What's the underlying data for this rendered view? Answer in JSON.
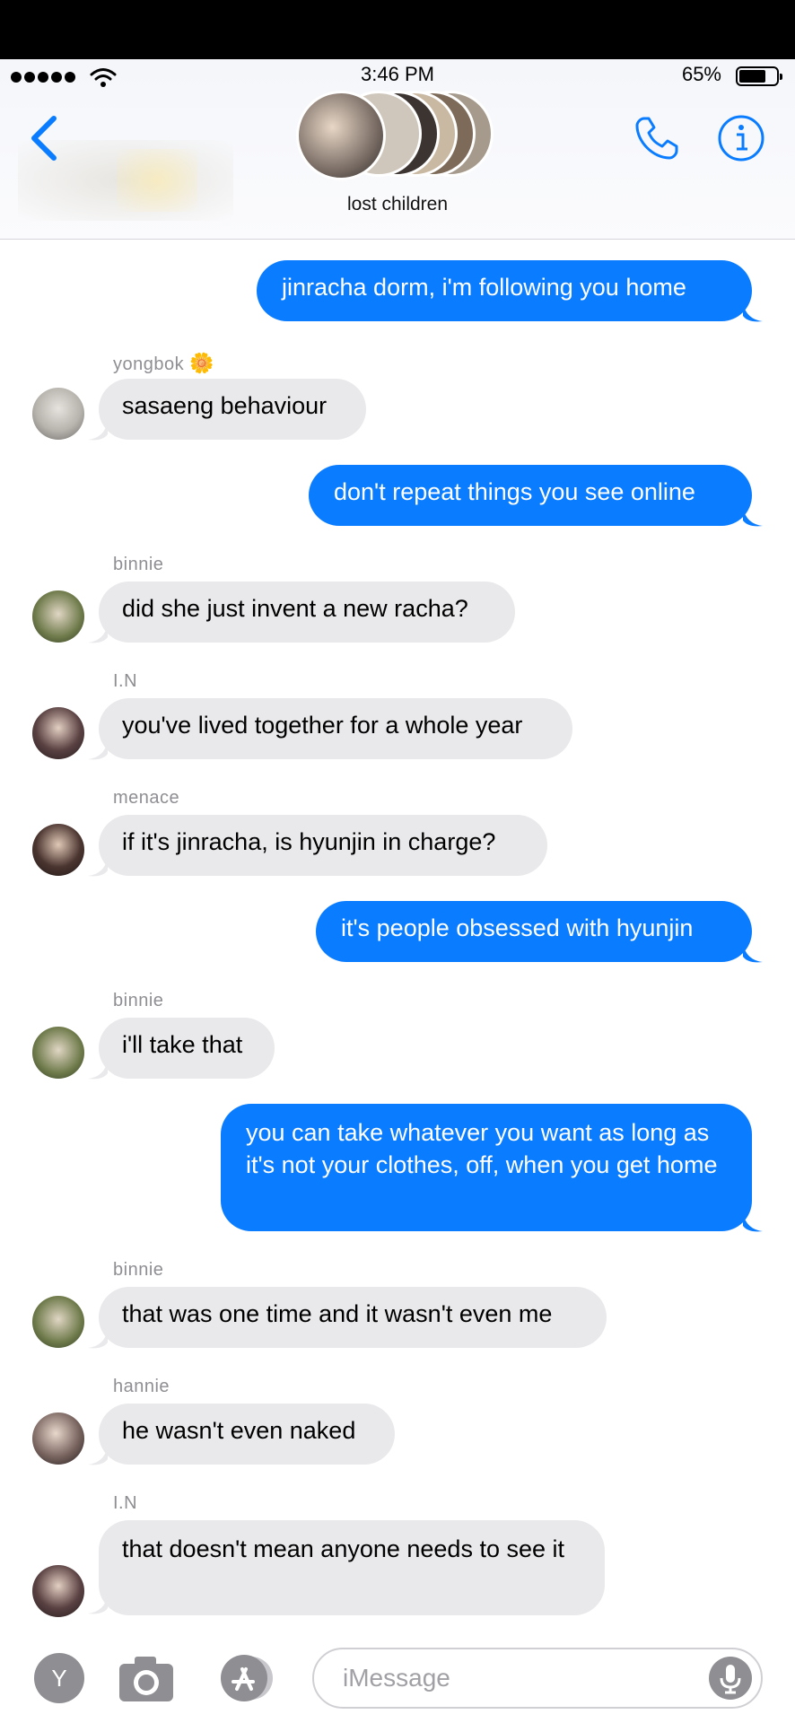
{
  "status_bar": {
    "time": "3:46 PM",
    "battery": "65%"
  },
  "header": {
    "group_name": "lost children"
  },
  "messages": [
    {
      "text": "jinracha dorm, i'm following you home"
    },
    {
      "sender": "yongbok",
      "emoji": "🌼",
      "text": "sasaeng behaviour"
    },
    {
      "text": "don't repeat things you see online"
    },
    {
      "sender": "binnie",
      "text": "did she just invent a new racha?"
    },
    {
      "sender": "I.N",
      "text": "you've lived together for a whole year"
    },
    {
      "sender": "menace",
      "text": "if it's jinracha, is hyunjin in charge?"
    },
    {
      "text": "it's people obsessed with hyunjin"
    },
    {
      "sender": "binnie",
      "text": "i'll take that"
    },
    {
      "text": "you can take whatever you want as long as it's not your clothes, off, when you get home"
    },
    {
      "sender": "binnie",
      "text": "that was one time and it wasn't even me"
    },
    {
      "sender": "hannie",
      "text": "he wasn't even naked"
    },
    {
      "sender": "I.N",
      "text": "that doesn't mean anyone needs to see it"
    }
  ],
  "input_bar": {
    "apps_label": "Y",
    "placeholder": "iMessage"
  },
  "colors": {
    "outgoing": "#0a7cff",
    "incoming": "#e9e9eb",
    "accent": "#0a7cff"
  }
}
